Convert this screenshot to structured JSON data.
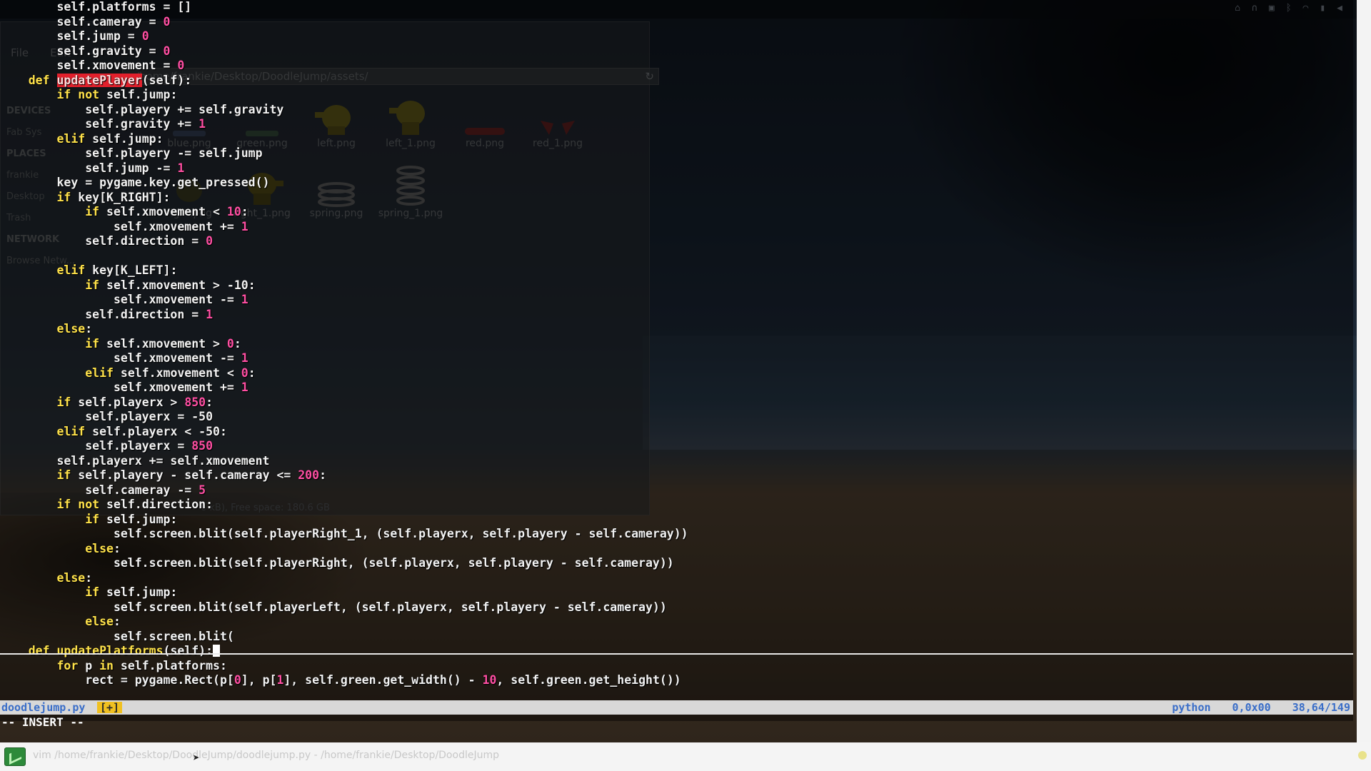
{
  "file_manager": {
    "menu": [
      "File",
      "Edit"
    ],
    "path": "/home/frankie/Desktop/DoodleJump/assets/",
    "sidebar": [
      "DEVICES",
      "Fab Sys",
      "PLACES",
      "frankie",
      "Desktop",
      "Trash",
      "NETWORK",
      "Browse Netw..."
    ],
    "files": [
      {
        "name": "blue.png"
      },
      {
        "name": "green.png"
      },
      {
        "name": "left.png"
      },
      {
        "name": "left_1.png"
      },
      {
        "name": "red.png"
      },
      {
        "name": "red_1.png"
      },
      {
        "name": "right.png"
      },
      {
        "name": "right_1.png"
      },
      {
        "name": "spring.png"
      },
      {
        "name": "spring_1.png"
      }
    ],
    "status": "6 kB), Free space: 180.6 GB"
  },
  "editor": {
    "lines": [
      "        self.platforms = []",
      "        self.cameray = 0",
      "        self.jump = 0",
      "        self.gravity = 0",
      "        self.xmovement = 0",
      "    def updatePlayer(self):",
      "        if not self.jump:",
      "            self.playery += self.gravity",
      "            self.gravity += 1",
      "        elif self.jump:",
      "            self.playery -= self.jump",
      "            self.jump -= 1",
      "        key = pygame.key.get_pressed()",
      "        if key[K_RIGHT]:",
      "            if self.xmovement < 10:",
      "                self.xmovement += 1",
      "            self.direction = 0",
      "",
      "        elif key[K_LEFT]:",
      "            if self.xmovement > -10:",
      "                self.xmovement -= 1",
      "            self.direction = 1",
      "        else:",
      "            if self.xmovement > 0:",
      "                self.xmovement -= 1",
      "            elif self.xmovement < 0:",
      "                self.xmovement += 1",
      "        if self.playerx > 850:",
      "            self.playerx = -50",
      "        elif self.playerx < -50:",
      "            self.playerx = 850",
      "        self.playerx += self.xmovement",
      "        if self.playery - self.cameray <= 200:",
      "            self.cameray -= 5",
      "        if not self.direction:",
      "            if self.jump:",
      "                self.screen.blit(self.playerRight_1, (self.playerx, self.playery - self.cameray))",
      "            else:",
      "                self.screen.blit(self.playerRight, (self.playerx, self.playery - self.cameray))",
      "        else:",
      "            if self.jump:",
      "                self.screen.blit(self.playerLeft, (self.playerx, self.playery - self.cameray))",
      "            else:",
      "                self.screen.blit(",
      "    def updatePlatforms(self):",
      "        for p in self.platforms:",
      "            rect = pygame.Rect(p[0], p[1], self.green.get_width() - 10, self.green.get_height())"
    ],
    "highlighted_function": "updatePlayer",
    "cursor_line": 44,
    "status": {
      "filename": "doodlejump.py",
      "modified": "[+]",
      "filetype": "python",
      "encoding": "0,0x00",
      "position": "38,64/149"
    },
    "mode": "-- INSERT --"
  },
  "taskbar": {
    "text": "vim /home/frankie/Desktop/DoodleJump/doodlejump.py - /home/frankie/Desktop/DoodleJump"
  },
  "colors": {
    "keyword": "#ffe24a",
    "number": "#ff4fa3",
    "search_highlight": "#e2202c"
  }
}
